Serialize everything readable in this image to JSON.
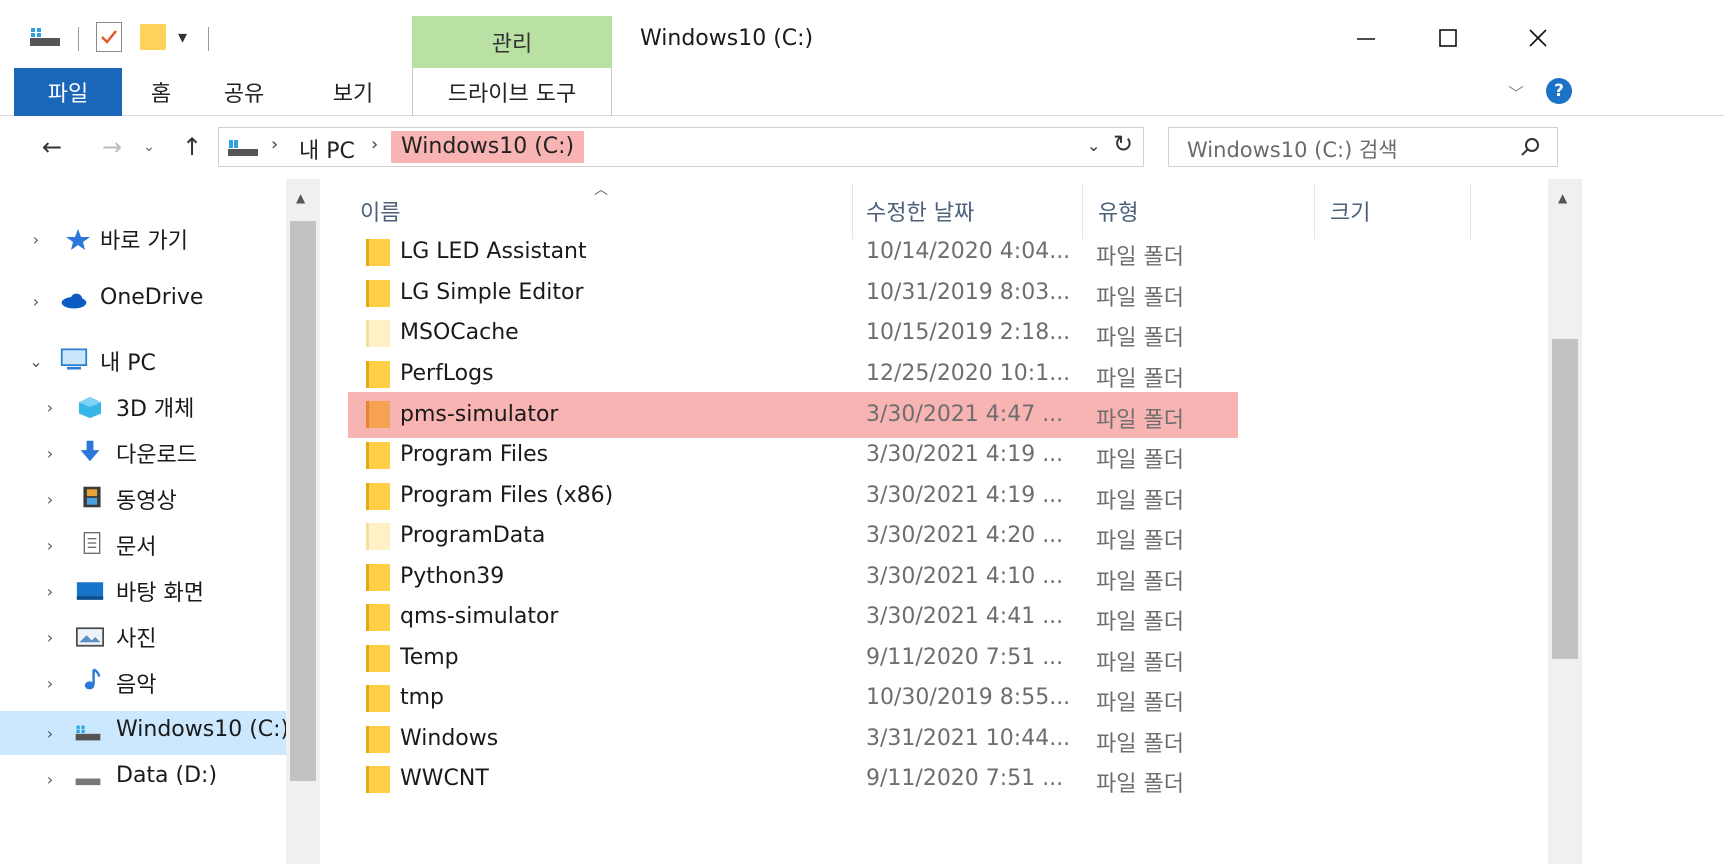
{
  "window": {
    "title": "Windows10 (C:)",
    "contextual_group": "관리",
    "minimize_icon": "minimize-icon",
    "maximize_icon": "maximize-icon",
    "close_icon": "close-icon"
  },
  "ribbon": {
    "tabs": [
      {
        "label": "파일"
      },
      {
        "label": "홈"
      },
      {
        "label": "공유"
      },
      {
        "label": "보기"
      },
      {
        "label": "드라이브 도구"
      }
    ],
    "help": "?"
  },
  "address": {
    "crumbs": [
      "내 PC",
      "Windows10 (C:)"
    ],
    "search_placeholder": "Windows10 (C:) 검색"
  },
  "nav_pane": {
    "items": [
      {
        "label": "바로 가기",
        "icon": "star-icon"
      },
      {
        "label": "OneDrive",
        "icon": "cloud-icon"
      },
      {
        "label": "내 PC",
        "icon": "computer-icon"
      },
      {
        "label": "3D 개체",
        "icon": "cube-icon"
      },
      {
        "label": "다운로드",
        "icon": "download-icon"
      },
      {
        "label": "동영상",
        "icon": "video-icon"
      },
      {
        "label": "문서",
        "icon": "document-icon"
      },
      {
        "label": "바탕 화면",
        "icon": "desktop-icon"
      },
      {
        "label": "사진",
        "icon": "pictures-icon"
      },
      {
        "label": "음악",
        "icon": "music-icon"
      },
      {
        "label": "Windows10 (C:)",
        "icon": "drive-icon"
      },
      {
        "label": "Data (D:)",
        "icon": "drive-icon"
      }
    ]
  },
  "file_list": {
    "columns": [
      "이름",
      "수정한 날짜",
      "유형",
      "크기"
    ],
    "rows": [
      {
        "name": "LG LED Assistant",
        "date": "10/14/2020 4:04...",
        "type": "파일 폴더"
      },
      {
        "name": "LG Simple Editor",
        "date": "10/31/2019 8:03...",
        "type": "파일 폴더"
      },
      {
        "name": "MSOCache",
        "date": "10/15/2019 2:18...",
        "type": "파일 폴더"
      },
      {
        "name": "PerfLogs",
        "date": "12/25/2020 10:1...",
        "type": "파일 폴더"
      },
      {
        "name": "pms-simulator",
        "date": "3/30/2021 4:47 ...",
        "type": "파일 폴더"
      },
      {
        "name": "Program Files",
        "date": "3/30/2021 4:19 ...",
        "type": "파일 폴더"
      },
      {
        "name": "Program Files (x86)",
        "date": "3/30/2021 4:19 ...",
        "type": "파일 폴더"
      },
      {
        "name": "ProgramData",
        "date": "3/30/2021 4:20 ...",
        "type": "파일 폴더"
      },
      {
        "name": "Python39",
        "date": "3/30/2021 4:10 ...",
        "type": "파일 폴더"
      },
      {
        "name": "qms-simulator",
        "date": "3/30/2021 4:41 ...",
        "type": "파일 폴더"
      },
      {
        "name": "Temp",
        "date": "9/11/2020 7:51 ...",
        "type": "파일 폴더"
      },
      {
        "name": "tmp",
        "date": "10/30/2019 8:55...",
        "type": "파일 폴더"
      },
      {
        "name": "Windows",
        "date": "3/31/2021 10:44...",
        "type": "파일 폴더"
      },
      {
        "name": "WWCNT",
        "date": "9/11/2020 7:51 ...",
        "type": "파일 폴더"
      }
    ]
  },
  "colors": {
    "highlight": "#f8b3b3",
    "file_tab": "#1a66b8",
    "manage_tab": "#b8e1a3",
    "selected_nav": "#cce8ff"
  }
}
